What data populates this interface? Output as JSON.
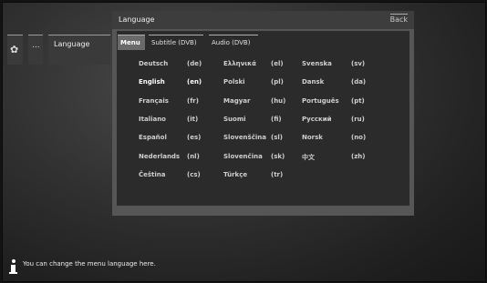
{
  "breadcrumb": {
    "gear_icon": "gear-icon",
    "dots": "...",
    "current": "Language"
  },
  "panel": {
    "title": "Language",
    "back": "Back",
    "tabs": [
      "Menu",
      "Subtitle (DVB)",
      "Audio (DVB)"
    ],
    "active_tab": "Menu"
  },
  "languages": {
    "col1": [
      {
        "name": "Deutsch",
        "code": "(de)"
      },
      {
        "name": "English",
        "code": "(en)"
      },
      {
        "name": "Français",
        "code": "(fr)"
      },
      {
        "name": "Italiano",
        "code": "(it)"
      },
      {
        "name": "Español",
        "code": "(es)"
      },
      {
        "name": "Nederlands",
        "code": "(nl)"
      },
      {
        "name": "Čeština",
        "code": "(cs)"
      }
    ],
    "col2": [
      {
        "name": "Ελληνικά",
        "code": "(el)"
      },
      {
        "name": "Polski",
        "code": "(pl)"
      },
      {
        "name": "Magyar",
        "code": "(hu)"
      },
      {
        "name": "Suomi",
        "code": "(fi)"
      },
      {
        "name": "Slovenščina",
        "code": "(sl)"
      },
      {
        "name": "Slovenčina",
        "code": "(sk)"
      },
      {
        "name": "Türkçe",
        "code": "(tr)"
      }
    ],
    "col3": [
      {
        "name": "Svenska",
        "code": "(sv)"
      },
      {
        "name": "Dansk",
        "code": "(da)"
      },
      {
        "name": "Português",
        "code": "(pt)"
      },
      {
        "name": "Русский",
        "code": "(ru)"
      },
      {
        "name": "Norsk",
        "code": "(no)"
      },
      {
        "name": "中文",
        "code": "(zh)"
      }
    ],
    "selected": "English"
  },
  "info": {
    "icon": "info-icon",
    "text": "You can change the menu language here."
  }
}
